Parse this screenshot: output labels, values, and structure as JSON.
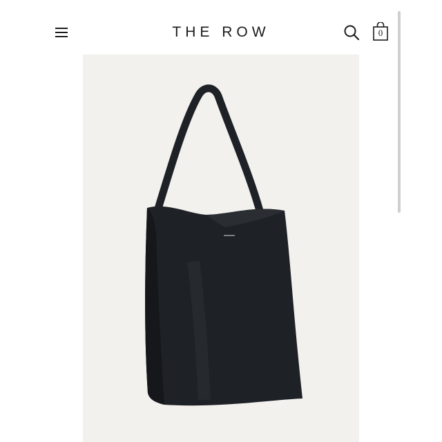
{
  "header": {
    "brand": "THE ROW",
    "menu_icon": "hamburger-menu-icon",
    "search_icon": "search-icon",
    "bag_icon": "shopping-bag-icon",
    "bag_count": "0"
  },
  "product": {
    "image": "black-leather-tote-bag-photo",
    "background_color": "#f3f1ee",
    "bag_color": "#1e2125"
  }
}
